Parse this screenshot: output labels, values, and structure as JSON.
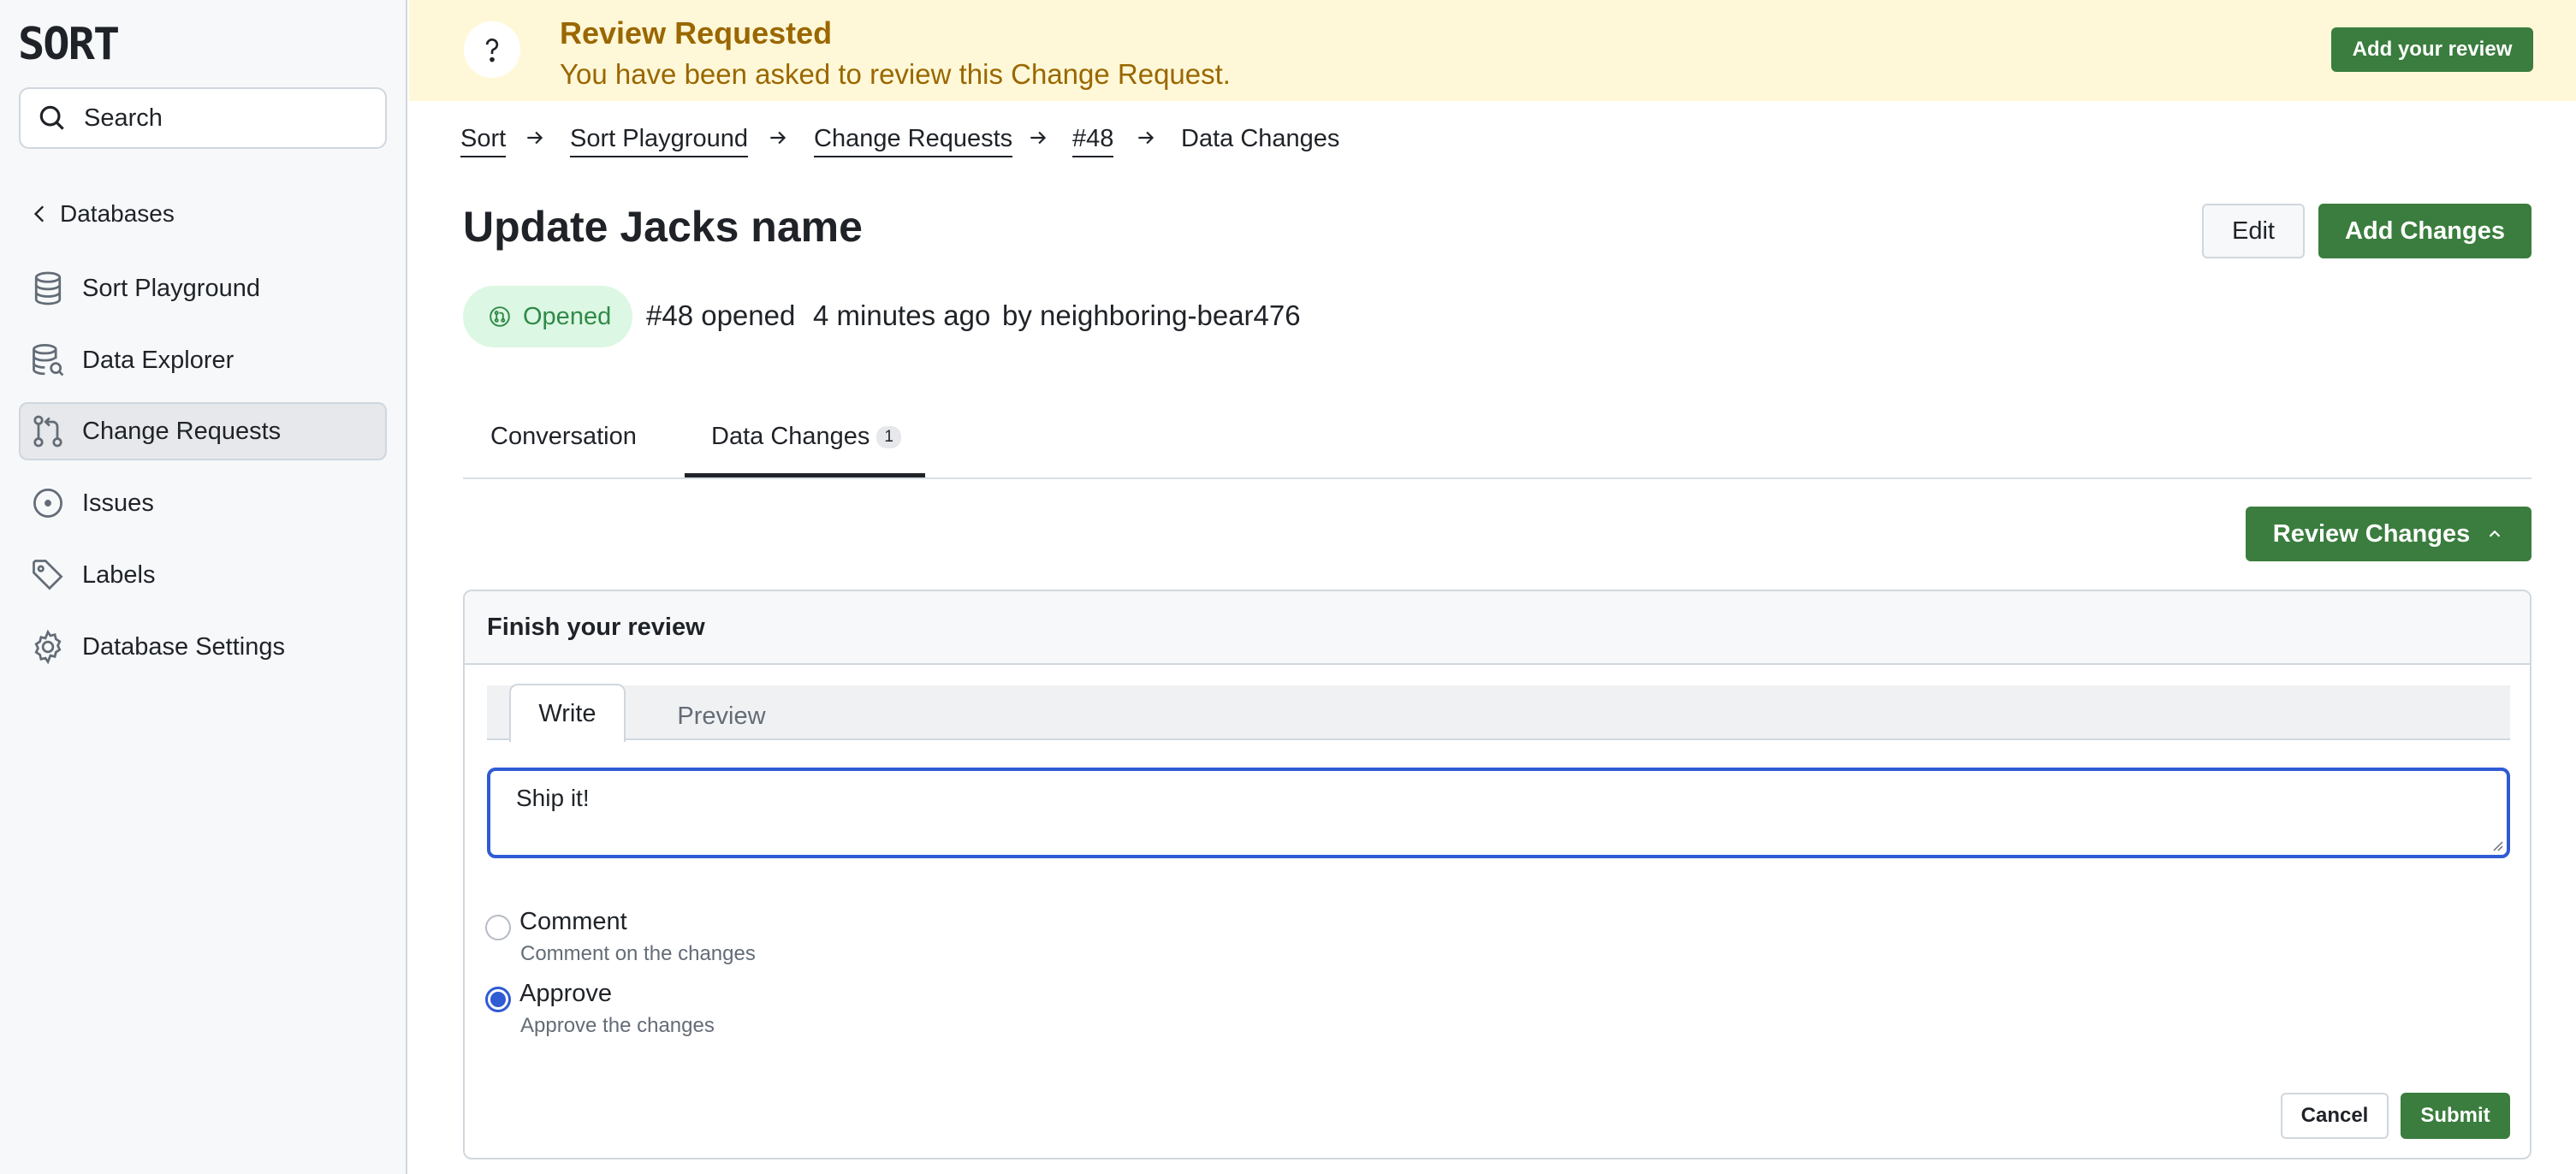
{
  "app": {
    "logo_text": "SORT"
  },
  "sidebar": {
    "search_placeholder": "Search",
    "back_label": "Databases",
    "items": [
      {
        "label": "Sort Playground",
        "icon": "database-icon",
        "active": false
      },
      {
        "label": "Data Explorer",
        "icon": "database-search-icon",
        "active": false
      },
      {
        "label": "Change Requests",
        "icon": "pull-request-icon",
        "active": true
      },
      {
        "label": "Issues",
        "icon": "issue-circle-icon",
        "active": false
      },
      {
        "label": "Labels",
        "icon": "tag-icon",
        "active": false
      },
      {
        "label": "Database Settings",
        "icon": "gear-icon",
        "active": false
      }
    ]
  },
  "banner": {
    "title": "Review Requested",
    "subtitle": "You have been asked to review this Change Request.",
    "action_label": "Add your review",
    "icon": "question-icon",
    "background_color": "#fff8d8",
    "text_color": "#9a6700"
  },
  "breadcrumb": [
    "Sort",
    "Sort Playground",
    "Change Requests",
    "#48",
    "Data Changes"
  ],
  "header": {
    "title": "Update Jacks name",
    "edit_label": "Edit",
    "add_changes_label": "Add Changes",
    "status": "Opened",
    "number_opened": "#48 opened",
    "time_ago": "4 minutes ago",
    "author": "by neighboring-bear476"
  },
  "tabs": {
    "conversation": "Conversation",
    "data_changes": "Data Changes",
    "data_changes_count": "1",
    "active": "Data Changes"
  },
  "review": {
    "toggle_label": "Review Changes",
    "panel_title": "Finish your review",
    "editor_tabs": [
      "Write",
      "Preview"
    ],
    "comment_text": "Ship it!",
    "options": [
      {
        "label": "Comment",
        "description": "Comment on the changes",
        "selected": false
      },
      {
        "label": "Approve",
        "description": "Approve the changes",
        "selected": true
      }
    ],
    "cancel_label": "Cancel",
    "submit_label": "Submit"
  },
  "colors": {
    "accent_green": "#3a7d3e",
    "focus_blue": "#2f5bd3",
    "opened_badge_bg": "#dcf7e3",
    "opened_badge_text": "#2f8a48"
  }
}
